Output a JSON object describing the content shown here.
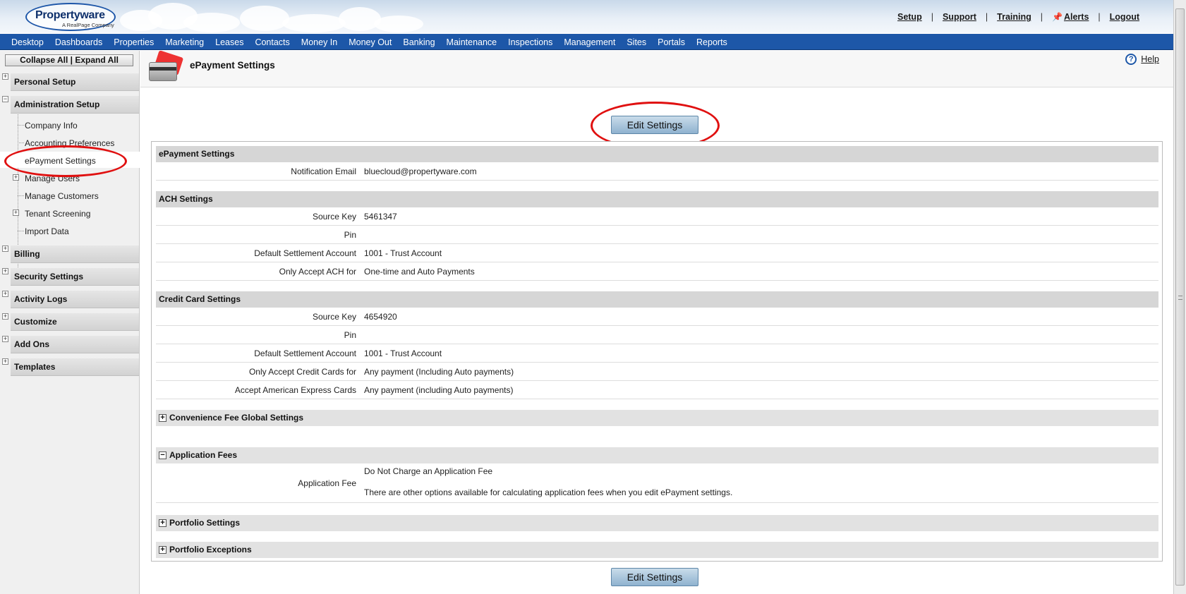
{
  "header": {
    "logo_text": "Propertyware",
    "logo_sub": "A RealPage Company",
    "links": {
      "setup": "Setup",
      "support": "Support",
      "training": "Training",
      "alerts": "Alerts",
      "logout": "Logout"
    },
    "sep": "|"
  },
  "nav": {
    "items": [
      "Desktop",
      "Dashboards",
      "Properties",
      "Marketing",
      "Leases",
      "Contacts",
      "Money In",
      "Money Out",
      "Banking",
      "Maintenance",
      "Inspections",
      "Management",
      "Sites",
      "Portals",
      "Reports"
    ]
  },
  "sidebar": {
    "collapse_label": "Collapse All |  Expand All",
    "sections": {
      "personal": "Personal Setup",
      "admin": "Administration Setup",
      "billing": "Billing",
      "security": "Security Settings",
      "activity": "Activity Logs",
      "customize": "Customize",
      "addons": "Add Ons",
      "templates": "Templates"
    },
    "admin_items": {
      "company_info": "Company Info",
      "accounting": "Accounting Preferences",
      "epayment": "ePayment Settings",
      "users": "Manage Users",
      "customers": "Manage Customers",
      "screening": "Tenant Screening",
      "import": "Import Data"
    },
    "plus": "+",
    "minus": "−"
  },
  "page": {
    "title": "ePayment Settings",
    "help_label": "Help",
    "edit_button": "Edit Settings"
  },
  "sections": {
    "epayment": {
      "title": "ePayment Settings",
      "notification_label": "Notification Email",
      "notification_value": "bluecloud@propertyware.com"
    },
    "ach": {
      "title": "ACH Settings",
      "rows": [
        {
          "label": "Source Key",
          "value": "5461347"
        },
        {
          "label": "Pin",
          "value": ""
        },
        {
          "label": "Default Settlement Account",
          "value": "1001 - Trust Account"
        },
        {
          "label": "Only Accept ACH for",
          "value": "One-time and Auto Payments"
        }
      ]
    },
    "cc": {
      "title": "Credit Card Settings",
      "rows": [
        {
          "label": "Source Key",
          "value": "4654920"
        },
        {
          "label": "Pin",
          "value": ""
        },
        {
          "label": "Default Settlement Account",
          "value": "1001 - Trust Account"
        },
        {
          "label": "Only Accept Credit Cards for",
          "value": "Any payment (Including Auto payments)"
        },
        {
          "label": "Accept American Express Cards",
          "value": "Any payment (including Auto payments)"
        }
      ]
    },
    "convenience": {
      "title": "Convenience Fee Global Settings"
    },
    "app_fees": {
      "title": "Application Fees",
      "label": "Application Fee",
      "value": "Do Not Charge an Application Fee",
      "note": "There are other options available for calculating application fees when you edit ePayment settings."
    },
    "portfolio_settings": {
      "title": "Portfolio Settings"
    },
    "portfolio_exceptions": {
      "title": "Portfolio Exceptions"
    }
  },
  "colors": {
    "nav_bg": "#1d57a8",
    "highlight": "#e01010"
  }
}
